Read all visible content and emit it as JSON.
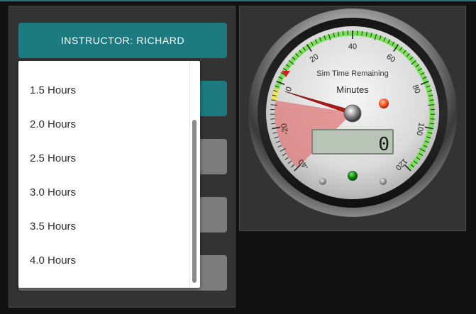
{
  "instructor_button": {
    "label": "INSTRUCTOR: RICHARD"
  },
  "duration_dropdown": {
    "options": [
      "1.5 Hours",
      "2.0 Hours",
      "2.5 Hours",
      "3.0 Hours",
      "3.5 Hours",
      "4.0 Hours"
    ]
  },
  "gauge": {
    "title": "Sim Time Remaining",
    "unit": "Minutes",
    "scale_labels": [
      "-40",
      "-20",
      "0",
      "20",
      "40",
      "60",
      "80",
      "100",
      "120"
    ],
    "scale_min": -40,
    "scale_max": 120,
    "needle_value": -3,
    "digital_readout": "0",
    "colors": {
      "accent": "#1d7b80",
      "green_zone": "#7ae05a",
      "red_zone": "#e07a7a",
      "yellow_zone": "#e8e84a",
      "needle": "#b01818",
      "led_orange": "#ff5a2a",
      "led_green": "#0e8a0e",
      "lcd": "#b7c4b6"
    }
  }
}
